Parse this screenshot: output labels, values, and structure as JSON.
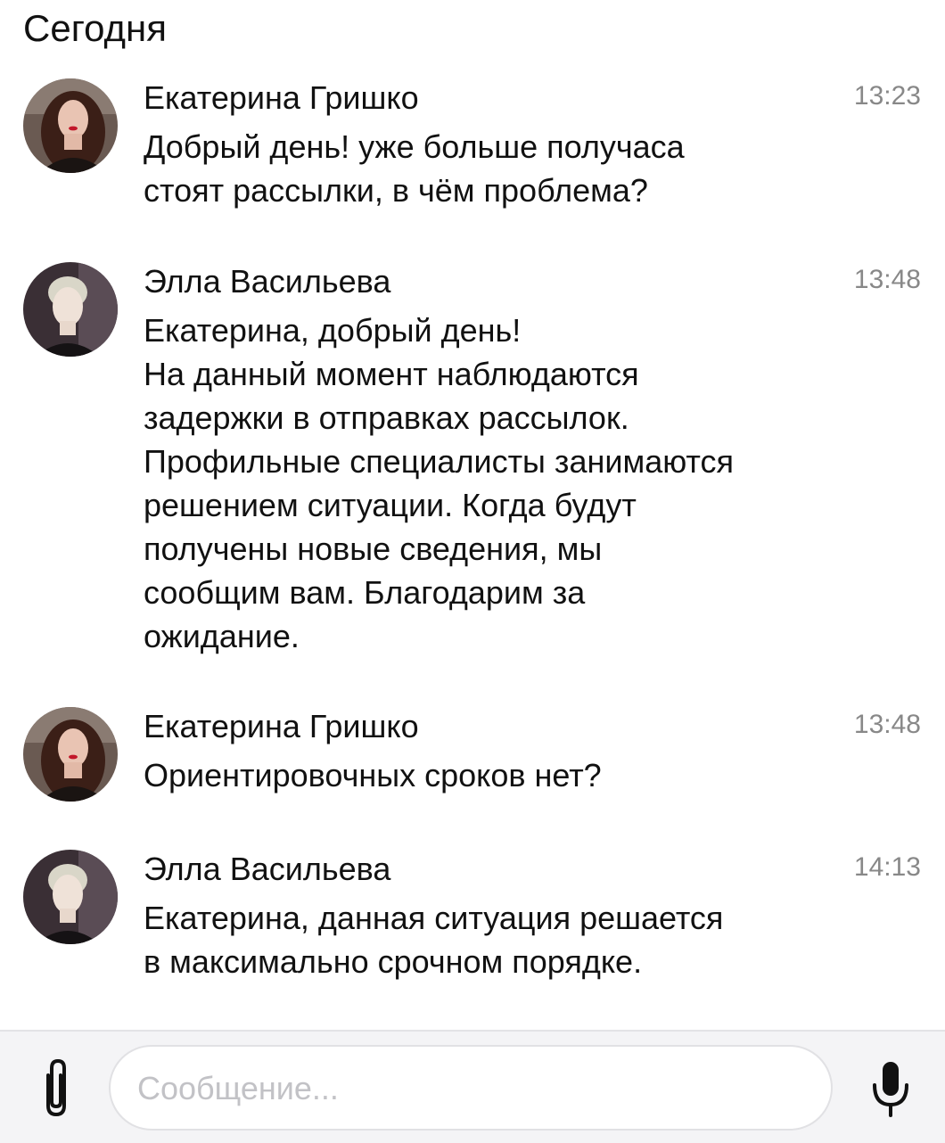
{
  "chat": {
    "date_header": "Сегодня",
    "messages": [
      {
        "sender": "Екатерина Гришко",
        "time": "13:23",
        "avatar": "avatar-ekaterina",
        "lines": [
          "Добрый день! уже больше получаса",
          "стоят рассылки, в чём проблема?"
        ]
      },
      {
        "sender": "Элла Васильева",
        "time": "13:48",
        "avatar": "avatar-ella",
        "lines": [
          "Екатерина, добрый день!",
          "На данный момент наблюдаются",
          "задержки в отправках рассылок.",
          "Профильные специалисты занимаются",
          "решением ситуации. Когда будут",
          "получены новые сведения, мы",
          "сообщим вам. Благодарим за",
          "ожидание."
        ]
      },
      {
        "sender": "Екатерина Гришко",
        "time": "13:48",
        "avatar": "avatar-ekaterina",
        "lines": [
          "Ориентировочных сроков нет?"
        ]
      },
      {
        "sender": "Элла Васильева",
        "time": "14:13",
        "avatar": "avatar-ella",
        "lines": [
          "Екатерина, данная ситуация решается",
          "в максимально срочном порядке."
        ]
      }
    ]
  },
  "composer": {
    "placeholder": "Сообщение...",
    "value": "",
    "attach_icon": "paperclip-icon",
    "mic_icon": "microphone-icon"
  },
  "colors": {
    "text": "#111111",
    "time": "#888888",
    "composer_bg": "#f4f4f6",
    "placeholder": "#c2c2c6"
  }
}
